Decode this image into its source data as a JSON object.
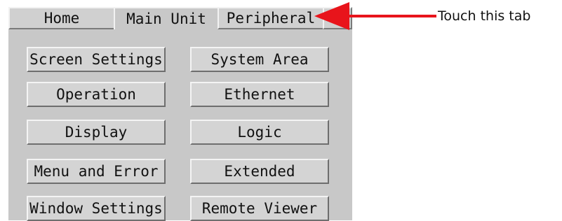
{
  "tabs": [
    {
      "label": "Home",
      "active": false
    },
    {
      "label": "Main Unit",
      "active": true
    },
    {
      "label": "Peripheral",
      "active": false
    }
  ],
  "buttons": {
    "left": [
      "Screen Settings",
      "Operation",
      "Display",
      "Menu and Error",
      "Window Settings"
    ],
    "right": [
      "System Area",
      "Ethernet",
      "Logic",
      "Extended",
      "Remote Viewer"
    ]
  },
  "annotation": {
    "text": "Touch this tab",
    "arrow_color": "#e8141b"
  }
}
